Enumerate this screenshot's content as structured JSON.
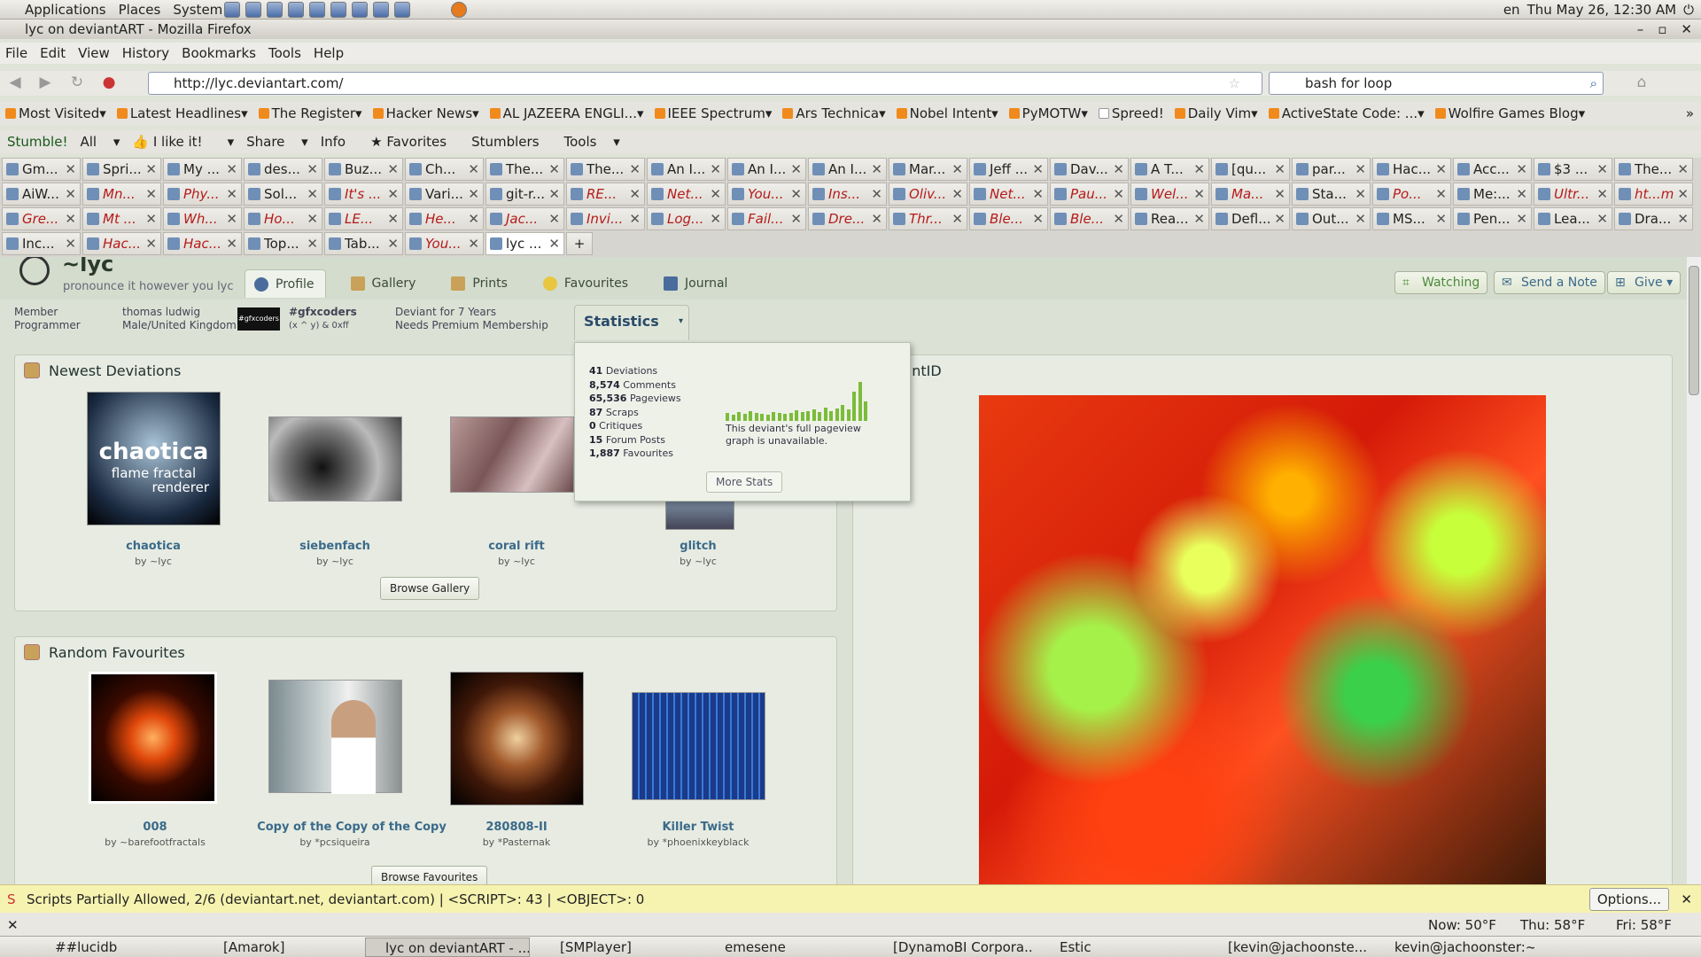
{
  "gnome": {
    "menus": [
      "Applications",
      "Places",
      "System"
    ],
    "keyboard": "en",
    "clock": "Thu May 26, 12:30 AM"
  },
  "window": {
    "title": "lyc on deviantART - Mozilla Firefox"
  },
  "menu": [
    "File",
    "Edit",
    "View",
    "History",
    "Bookmarks",
    "Tools",
    "Help"
  ],
  "nav": {
    "url": "http://lyc.deviantart.com/",
    "search": "bash for loop"
  },
  "bookmarks": [
    "Most Visited",
    "Latest Headlines",
    "The Register",
    "Hacker News",
    "AL JAZEERA ENGLI...",
    "IEEE Spectrum",
    "Ars Technica",
    "Nobel Intent",
    "PyMOTW",
    "Spreed!",
    "Daily Vim",
    "ActiveState Code: ...",
    "Wolfire Games Blog"
  ],
  "stumble": [
    "Stumble!",
    "All",
    "I like it!",
    "Share",
    "Info",
    "Favorites",
    "Stumblers",
    "Tools"
  ],
  "tabs": [
    [
      "Gm...",
      "Spri...",
      "My ...",
      "des...",
      "Buz...",
      "Ch...",
      "The...",
      "The...",
      "An I...",
      "An I...",
      "An I...",
      "Mar...",
      "Jeff ...",
      "Dav...",
      "A T...",
      "[qu...",
      "par...",
      "Hac...",
      "Acc...",
      "$3 ...",
      "The..."
    ],
    [
      "AiW...",
      "Mn...",
      "Phy...",
      "Sol...",
      "It's ...",
      "Vari...",
      "git-r...",
      "RE...",
      "Net...",
      "You...",
      "Ins...",
      "Oliv...",
      "Net...",
      "Pau...",
      "Wel...",
      "Ma...",
      "Sta...",
      "Po...",
      "Me:...",
      "Ultr...",
      "ht...m"
    ],
    [
      "Gre...",
      "Mt ...",
      "Wh...",
      "Ho...",
      "LE...",
      "He...",
      "Jac...",
      "Invi...",
      "Log...",
      "Fail...",
      "Dre...",
      "Thr...",
      "Ble...",
      "Ble...",
      "Rea...",
      "Defl...",
      "Out...",
      "MS...",
      "Pen...",
      "Lea...",
      "Dra..."
    ],
    [
      "Inc...",
      "Hac...",
      "Hac...",
      "Top...",
      "Tab...",
      "You...",
      "lyc ..."
    ]
  ],
  "profile": {
    "username": "~lyc",
    "tagline": "pronounce it however you lyc",
    "tabs": [
      "Profile",
      "Gallery",
      "Prints",
      "Favourites",
      "Journal"
    ],
    "buttons": {
      "watching": "Watching",
      "note": "Send a Note",
      "give": "Give"
    },
    "info": {
      "member": "Member",
      "role": "Programmer",
      "name": "thomas ludwig",
      "loc": "Male/United Kingdom",
      "group": "#gfxcoders",
      "group_sub": "(x ^ y) & 0xff",
      "since": "Deviant for 7 Years",
      "premium": "Needs Premium Membership"
    },
    "stats_tab": "Statistics",
    "newest_title": "Newest Deviations",
    "newest": [
      {
        "t": "chaotica",
        "by": "by ~lyc"
      },
      {
        "t": "siebenfach",
        "by": "by ~lyc"
      },
      {
        "t": "coral rift",
        "by": "by ~lyc"
      },
      {
        "t": "glitch",
        "by": "by ~lyc"
      }
    ],
    "chaotica_text": [
      "chaotica",
      "flame fractal",
      "renderer"
    ],
    "browse_gallery": "Browse Gallery",
    "random_title": "Random Favourites",
    "random": [
      {
        "t": "008",
        "by": "by ~barefootfractals"
      },
      {
        "t": "Copy of the Copy of the Copy",
        "by": "by *pcsiqueira"
      },
      {
        "t": "280808-II",
        "by": "by *Pasternak"
      },
      {
        "t": "Killer Twist",
        "by": "by *phoenixkeyblack"
      }
    ],
    "browse_fav": "Browse Favourites",
    "id_title": "iantID"
  },
  "stats": {
    "lines": [
      [
        "41",
        "Deviations"
      ],
      [
        "8,574",
        "Comments"
      ],
      [
        "65,536",
        "Pageviews"
      ],
      [
        "87",
        "Scraps"
      ],
      [
        "0",
        "Critiques"
      ],
      [
        "15",
        "Forum Posts"
      ],
      [
        "1,887",
        "Favourites"
      ]
    ],
    "graph_note": [
      "This deviant's full pageview",
      "graph is unavailable."
    ],
    "more": "More Stats",
    "bars": [
      8,
      6,
      9,
      7,
      10,
      8,
      7,
      6,
      9,
      8,
      7,
      8,
      11,
      9,
      10,
      12,
      9,
      14,
      10,
      13,
      16,
      12,
      30,
      40,
      20
    ]
  },
  "notif": {
    "text": "Scripts Partially Allowed, 2/6 (deviantart.net, deviantart.com) | <SCRIPT>: 43 | <OBJECT>: 0",
    "options": "Options..."
  },
  "weather": {
    "now": "Now: 50°F",
    "thu": "Thu: 58°F",
    "fri": "Fri: 58°F"
  },
  "taskbar": [
    "##lucidb",
    "[Amarok]",
    "lyc on deviantART - ...",
    "[SMPlayer]",
    "emesene",
    "[DynamoBI Corpora...",
    "Estic",
    "[kevin@jachoonste...",
    "kevin@jachoonster:~"
  ]
}
